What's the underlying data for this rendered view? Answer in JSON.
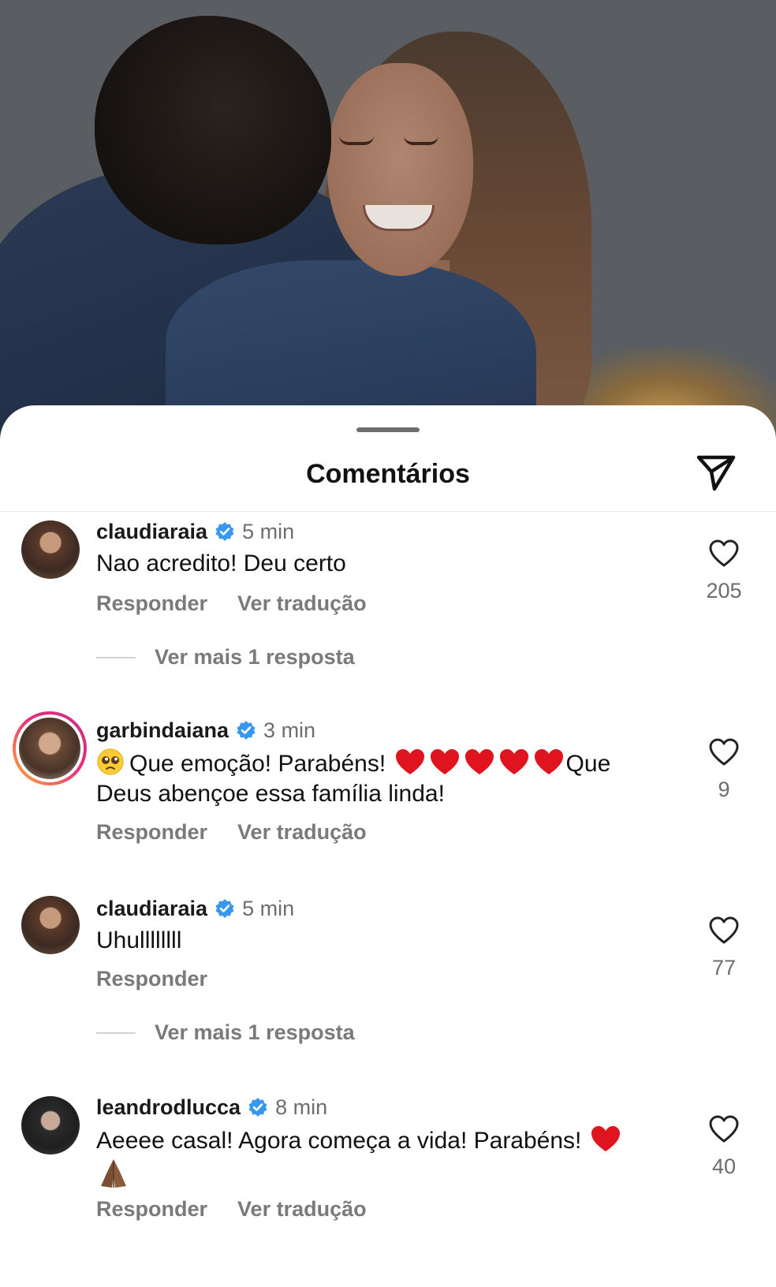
{
  "sheet": {
    "title": "Comentários"
  },
  "comments": [
    {
      "username": "claudiaraia",
      "verified": true,
      "time": "5 min",
      "text": "Nao acredito! Deu certo",
      "likes": "205",
      "reply_label": "Responder",
      "translate_label": "Ver tradução",
      "more_replies": "Ver mais 1 resposta"
    },
    {
      "username": "garbindaiana",
      "verified": true,
      "time": "3 min",
      "text_part1": "Que emoção! Parabéns!",
      "text_part2": "Que",
      "text_line2": "Deus abençoe essa família linda!",
      "likes": "9",
      "reply_label": "Responder",
      "translate_label": "Ver tradução"
    },
    {
      "username": "claudiaraia",
      "verified": true,
      "time": "5 min",
      "text": "Uhullllllll",
      "likes": "77",
      "reply_label": "Responder",
      "more_replies": "Ver mais 1 resposta"
    },
    {
      "username": "leandrodlucca",
      "verified": true,
      "time": "8 min",
      "text": "Aeeee casal! Agora começa a vida! Parabéns!",
      "likes": "40",
      "reply_label": "Responder",
      "translate_label": "Ver tradução"
    }
  ],
  "icons": {
    "share": "paper-plane-icon",
    "like": "heart-outline-icon",
    "verified": "verified-badge-icon"
  },
  "colors": {
    "verified_blue": "#3897f0",
    "heart_red": "#e0141e",
    "muted_text": "#7a7a7a"
  }
}
